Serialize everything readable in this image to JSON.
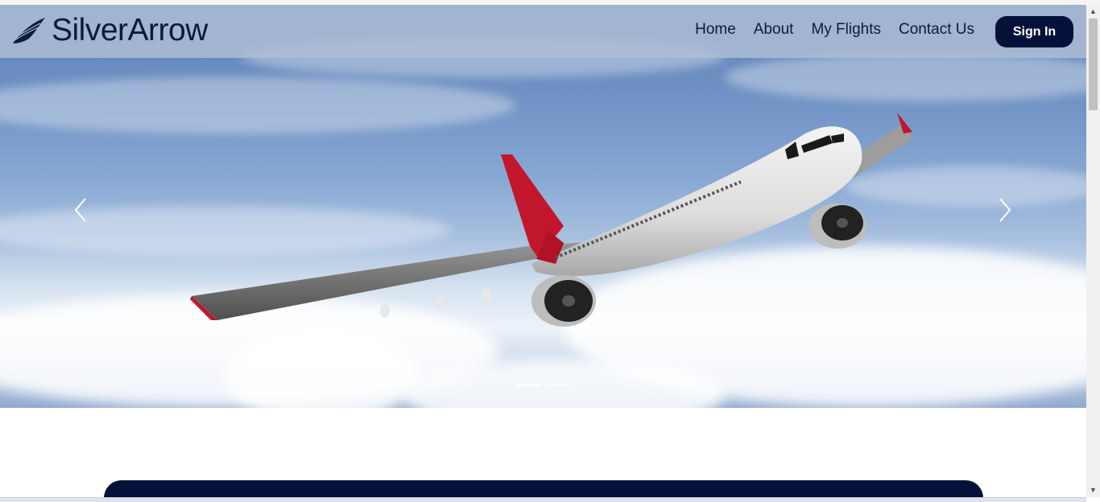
{
  "brand": {
    "name": "SilverArrow",
    "icon": "wing-icon"
  },
  "nav": {
    "items": [
      {
        "label": "Home"
      },
      {
        "label": "About"
      },
      {
        "label": "My Flights"
      },
      {
        "label": "Contact Us"
      }
    ],
    "signin_label": "Sign In"
  },
  "hero": {
    "image": "airplane-flying-above-clouds",
    "prev_icon": "chevron-left-icon",
    "next_icon": "chevron-right-icon",
    "slide_count": 2,
    "active_slide": 1
  },
  "colors": {
    "brand_dark": "#06113a",
    "navbar_bg": "#b0bed6",
    "text_dark": "#0c1a3d"
  }
}
